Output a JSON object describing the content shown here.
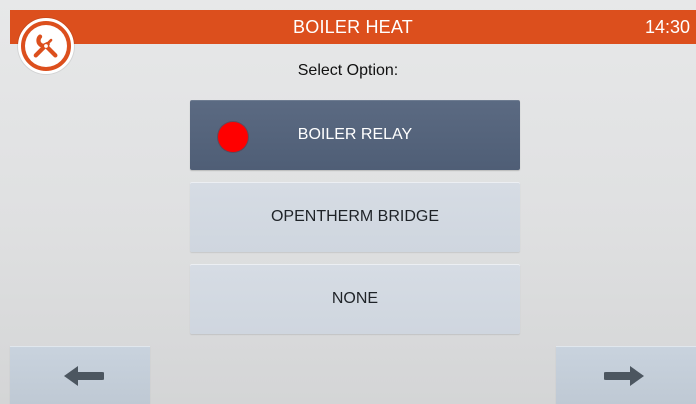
{
  "header": {
    "title": "BOILER HEAT",
    "time": "14:30",
    "accent_color": "#dc4f1d",
    "tool_icon": "wrench-screwdriver-icon"
  },
  "screen": {
    "prompt": "Select Option:"
  },
  "options": [
    {
      "label": "BOILER RELAY",
      "selected": true
    },
    {
      "label": "OPENTHERM BRIDGE",
      "selected": false
    },
    {
      "label": "NONE",
      "selected": false
    }
  ],
  "selection_indicator_color": "#ff0000",
  "nav": {
    "back_icon": "arrow-left-icon",
    "next_icon": "arrow-right-icon"
  }
}
